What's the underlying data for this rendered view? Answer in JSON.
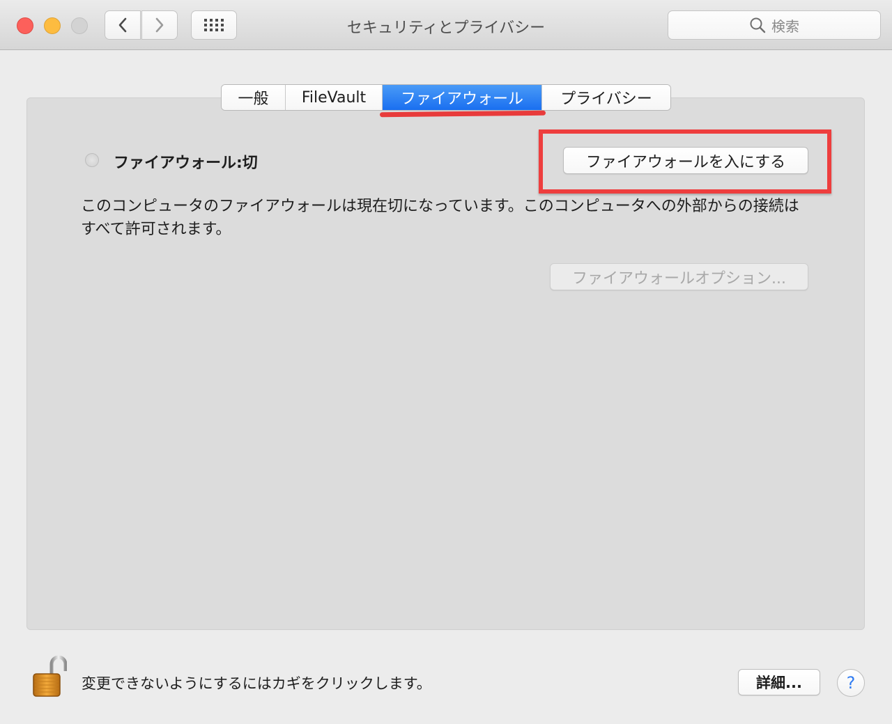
{
  "window": {
    "title": "セキュリティとプライバシー"
  },
  "toolbar": {
    "search_placeholder": "検索",
    "back_icon": "chevron-left-icon",
    "forward_icon": "chevron-right-icon",
    "grid_icon": "grid-icon"
  },
  "tabs": [
    {
      "label": "一般",
      "selected": false
    },
    {
      "label": "FileVault",
      "selected": false
    },
    {
      "label": "ファイアウォール",
      "selected": true
    },
    {
      "label": "プライバシー",
      "selected": false
    }
  ],
  "firewall": {
    "status_label": "ファイアウォール:切",
    "enable_button": "ファイアウォールを入にする",
    "description": "このコンピュータのファイアウォールは現在切になっています。このコンピュータへの外部からの接続はすべて許可されます。",
    "options_button": "ファイアウォールオプション..."
  },
  "footer": {
    "lock_text": "変更できないようにするにはカギをクリックします。",
    "details_button": "詳細...",
    "help_label": "?"
  },
  "colors": {
    "tab_selected": "#1a6ff0",
    "annotation_red": "#ee3e3e",
    "close": "#fc605b",
    "minimize": "#fdbc40"
  }
}
